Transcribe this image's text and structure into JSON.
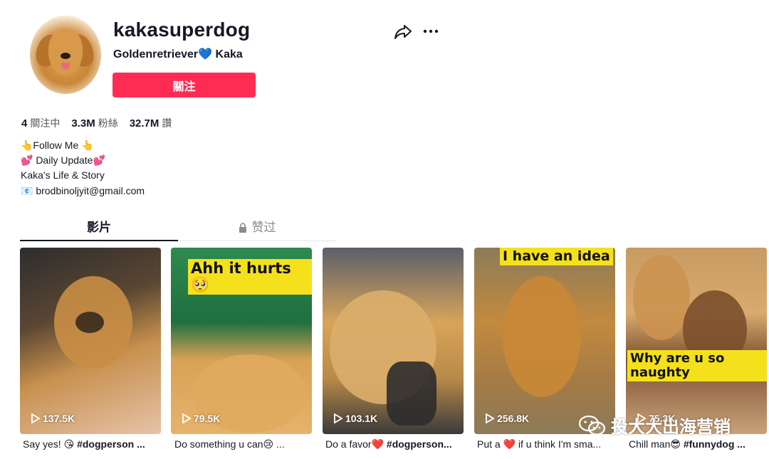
{
  "profile": {
    "username": "kakasuperdog",
    "subtitle_left": "Goldenretriever",
    "subtitle_heart": "💙",
    "subtitle_right": "Kaka",
    "follow_label": "關注"
  },
  "stats": {
    "following_count": "4",
    "following_label": "關注中",
    "followers_count": "3.3M",
    "followers_label": "粉絲",
    "likes_count": "32.7M",
    "likes_label": "讚"
  },
  "bio": {
    "line1": "👆Follow Me 👆",
    "line2": "💕 Daily Update💕",
    "line3": "Kaka's Life & Story",
    "line4": "📧 brodbinoljyit@gmail.com"
  },
  "tabs": {
    "videos": "影片",
    "liked": "赞过"
  },
  "videos": [
    {
      "views": "137.5K",
      "caption_text": "Say yes! 😘 ",
      "caption_tag": "#dogperson ..."
    },
    {
      "views": "79.5K",
      "overlay": "Ahh it hurts🥺",
      "caption_text": "Do something u can😢 ...",
      "caption_tag": ""
    },
    {
      "views": "103.1K",
      "caption_text": "Do a favor❤️ ",
      "caption_tag": "#dogperson..."
    },
    {
      "views": "256.8K",
      "overlay": "I have an idea",
      "caption_text": "Put a ❤️ if u think I'm sma...",
      "caption_tag": ""
    },
    {
      "views": "75.3K",
      "overlay": "Why are u so naughty",
      "caption_text": "Chill man😎 ",
      "caption_tag": "#funnydog ..."
    }
  ],
  "watermark": {
    "text": "投大大出海营销"
  }
}
